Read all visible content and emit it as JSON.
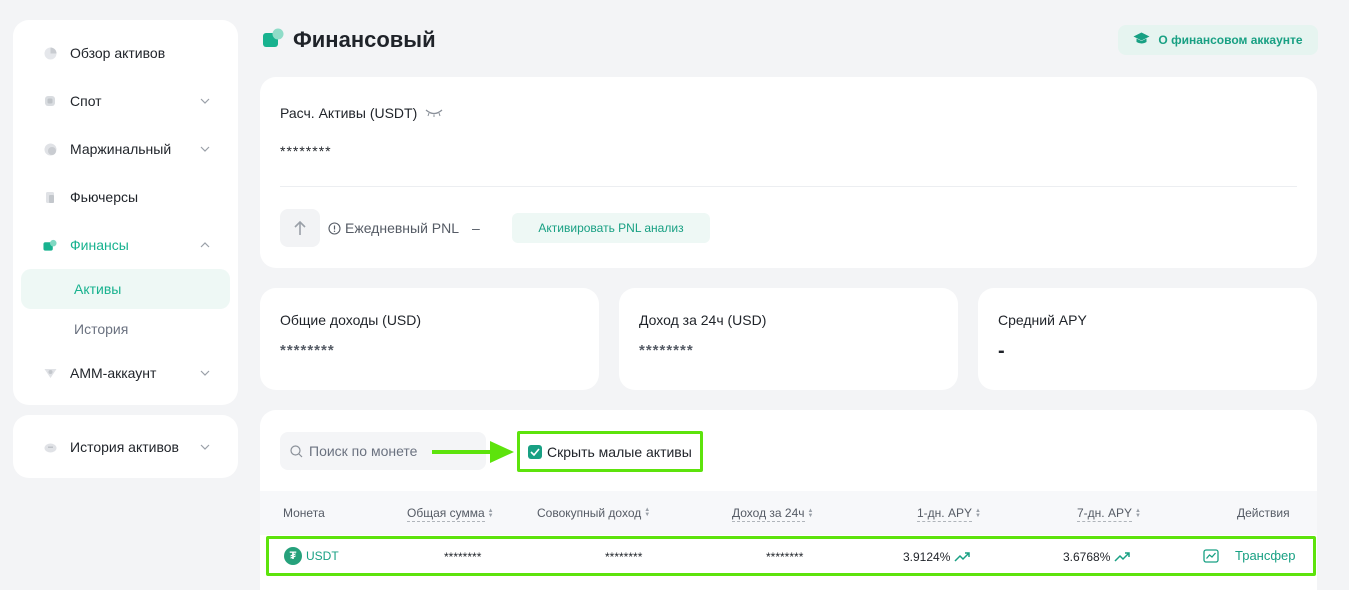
{
  "sidebar": {
    "items": [
      {
        "label": "Обзор активов",
        "icon": "pie-icon"
      },
      {
        "label": "Спот",
        "icon": "spot-icon"
      },
      {
        "label": "Маржинальный",
        "icon": "margin-icon"
      },
      {
        "label": "Фьючерсы",
        "icon": "futures-icon"
      },
      {
        "label": "Финансы",
        "icon": "finance-icon"
      },
      {
        "label": "Активы"
      },
      {
        "label": "История"
      },
      {
        "label": "АММ-аккаунт",
        "icon": "amm-icon"
      }
    ],
    "history_item": {
      "label": "История активов",
      "icon": "history-icon"
    }
  },
  "header": {
    "title": "Финансовый",
    "about_button": "О финансовом аккаунте"
  },
  "estimate": {
    "label": "Расч. Активы (USDT)",
    "value": "********",
    "daily_pnl_label": "Ежедневный PNL",
    "daily_pnl_value": "–",
    "activate_button": "Активировать PNL анализ"
  },
  "stats": [
    {
      "title": "Общие доходы (USD)",
      "value": "********"
    },
    {
      "title": "Доход за 24ч (USD)",
      "value": "********"
    },
    {
      "title": "Средний APY",
      "value": "-"
    }
  ],
  "filters": {
    "search_placeholder": "Поиск по монете",
    "hide_small_label": "Скрыть малые активы",
    "hide_small_checked": true
  },
  "table": {
    "columns": [
      "Монета",
      "Общая сумма",
      "Совокупный доход",
      "Доход за 24ч",
      "1-дн. APY",
      "7-дн. APY",
      "Действия"
    ],
    "rows": [
      {
        "coin": "USDT",
        "total": "********",
        "cumulative": "********",
        "income24h": "********",
        "apy1d": "3.9124%",
        "apy7d": "3.6768%",
        "action": "Трансфер"
      }
    ]
  },
  "colors": {
    "accent": "#18a083",
    "highlight": "#5de30c"
  }
}
